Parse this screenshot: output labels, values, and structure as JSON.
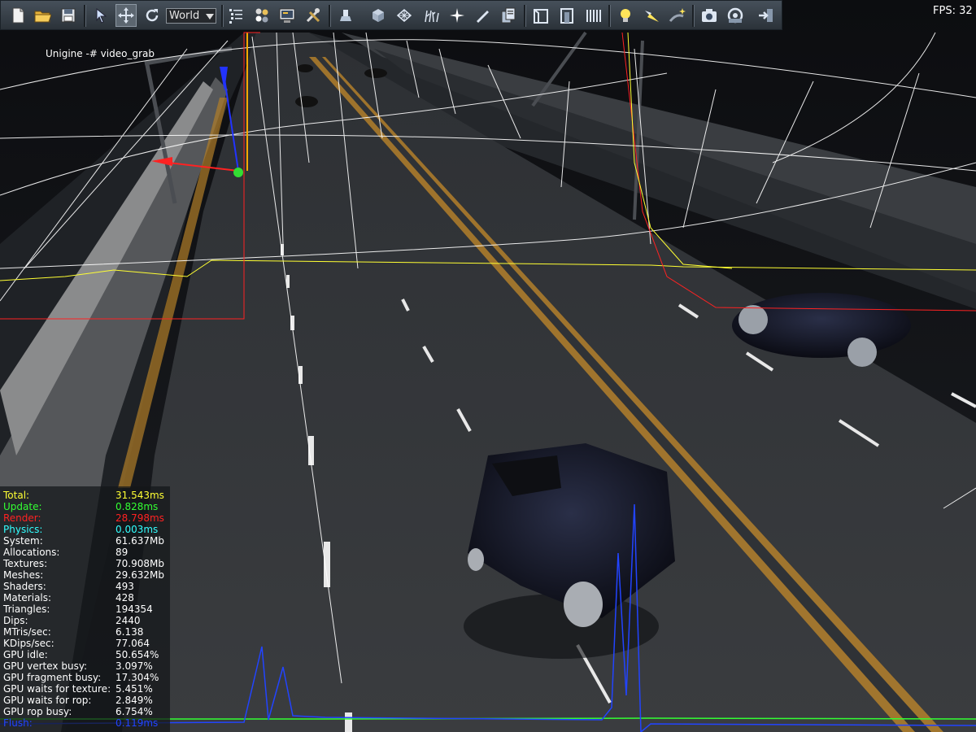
{
  "toolbar": {
    "tools": [
      {
        "name": "new-file-icon"
      },
      {
        "name": "open-folder-icon"
      },
      {
        "name": "save-icon"
      },
      {
        "name": "select-arrow-icon"
      },
      {
        "name": "move-cross-icon"
      },
      {
        "name": "rotate-icon"
      }
    ],
    "space_value": "World",
    "tools2": [
      {
        "name": "node-list-icon"
      },
      {
        "name": "materials-icon"
      },
      {
        "name": "render-settings-icon"
      },
      {
        "name": "tools-icon"
      },
      {
        "name": "object-icon"
      },
      {
        "name": "cube-icon"
      },
      {
        "name": "mesh-icon"
      },
      {
        "name": "grass-icon"
      },
      {
        "name": "particles-icon"
      },
      {
        "name": "decal-icon"
      },
      {
        "name": "clone-icon"
      },
      {
        "name": "sector-icon"
      },
      {
        "name": "portal-icon"
      },
      {
        "name": "occluder-icon"
      },
      {
        "name": "light-icon"
      },
      {
        "name": "spot-light-icon"
      },
      {
        "name": "world-light-icon"
      },
      {
        "name": "camera-icon"
      },
      {
        "name": "player-icon"
      },
      {
        "name": "exit-icon"
      }
    ]
  },
  "fps": "FPS: 32",
  "window_title": "Unigine -# video_grab",
  "stats": [
    {
      "label": "Total:",
      "value": "31.543ms",
      "color": "#ffff33"
    },
    {
      "label": "Update:",
      "value": "0.828ms",
      "color": "#33ff33"
    },
    {
      "label": "Render:",
      "value": "28.798ms",
      "color": "#ff2222"
    },
    {
      "label": "Physics:",
      "value": "0.003ms",
      "color": "#33ffff"
    },
    {
      "label": "System:",
      "value": "61.637Mb",
      "color": "#ffffff"
    },
    {
      "label": "Allocations:",
      "value": "89",
      "color": "#ffffff"
    },
    {
      "label": "Textures:",
      "value": "70.908Mb",
      "color": "#ffffff"
    },
    {
      "label": "Meshes:",
      "value": "29.632Mb",
      "color": "#ffffff"
    },
    {
      "label": "Shaders:",
      "value": "493",
      "color": "#ffffff"
    },
    {
      "label": "Materials:",
      "value": "428",
      "color": "#ffffff"
    },
    {
      "label": "Triangles:",
      "value": "194354",
      "color": "#ffffff"
    },
    {
      "label": "Dips:",
      "value": "2440",
      "color": "#ffffff"
    },
    {
      "label": "MTris/sec:",
      "value": "6.138",
      "color": "#ffffff"
    },
    {
      "label": "KDips/sec:",
      "value": "77.064",
      "color": "#ffffff"
    },
    {
      "label": "GPU idle:",
      "value": "50.654%",
      "color": "#ffffff"
    },
    {
      "label": "GPU vertex busy:",
      "value": "3.097%",
      "color": "#ffffff"
    },
    {
      "label": "GPU fragment busy:",
      "value": "17.304%",
      "color": "#ffffff"
    },
    {
      "label": "GPU waits for texture:",
      "value": "5.451%",
      "color": "#ffffff"
    },
    {
      "label": "GPU waits for rop:",
      "value": "2.849%",
      "color": "#ffffff"
    },
    {
      "label": "GPU rop busy:",
      "value": "6.754%",
      "color": "#ffffff"
    },
    {
      "label": "Flush:",
      "value": "0.119ms",
      "color": "#2244ff"
    }
  ],
  "colors": {
    "total": "#ffff33",
    "update": "#33ff33",
    "render": "#ff2222",
    "physics": "#33ffff",
    "flush": "#2244ff"
  }
}
